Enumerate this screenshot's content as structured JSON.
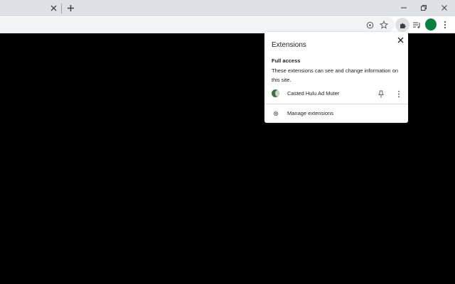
{
  "window": {
    "controls": {
      "minimize_icon": "minimize-icon",
      "restore_icon": "restore-icon",
      "close_icon": "close-icon"
    }
  },
  "tabs": {
    "close_icon": "close-icon",
    "new_tab_icon": "plus-icon"
  },
  "toolbar": {
    "icons": [
      "lens-icon",
      "star-icon",
      "puzzle-icon",
      "media-queue-icon",
      "avatar",
      "kebab-menu-icon"
    ],
    "avatar_color": "#0b8043"
  },
  "extensions_popup": {
    "title": "Extensions",
    "section_title": "Full access",
    "section_description": "These extensions can see and change information on this site.",
    "items": [
      {
        "name": "Casted Hulu Ad Muter",
        "icon": "extension-logo-icon"
      }
    ],
    "manage_label": "Manage extensions"
  },
  "colors": {
    "titlebar": "#dee1e6",
    "page_background": "#000000",
    "popup_background": "#ffffff",
    "text": "#202124"
  }
}
